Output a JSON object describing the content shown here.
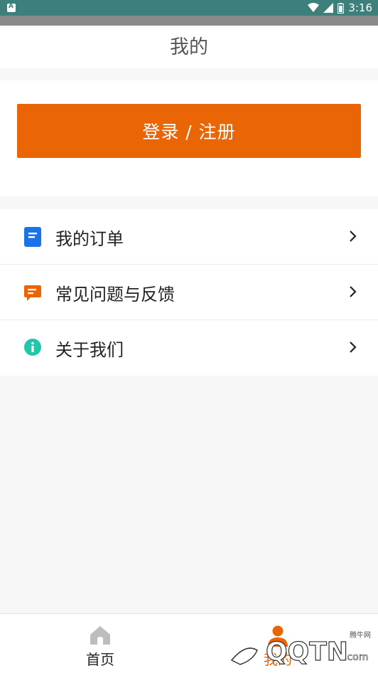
{
  "status_bar": {
    "time": "3:16"
  },
  "header": {
    "title": "我的"
  },
  "login": {
    "button_label": "登录 / 注册"
  },
  "menu": {
    "items": [
      {
        "label": "我的订单",
        "icon": "document-icon",
        "color": "#1a73e8"
      },
      {
        "label": "常见问题与反馈",
        "icon": "chat-icon",
        "color": "#ea6506"
      },
      {
        "label": "关于我们",
        "icon": "info-icon",
        "color": "#21c7a8"
      }
    ]
  },
  "tabbar": {
    "tabs": [
      {
        "label": "首页",
        "icon": "home-icon",
        "active": false
      },
      {
        "label": "我的",
        "icon": "user-icon",
        "active": true
      }
    ]
  },
  "colors": {
    "accent": "#ea6506",
    "status_bar": "#3d7f7a"
  },
  "watermark": {
    "text": "腾牛网"
  }
}
